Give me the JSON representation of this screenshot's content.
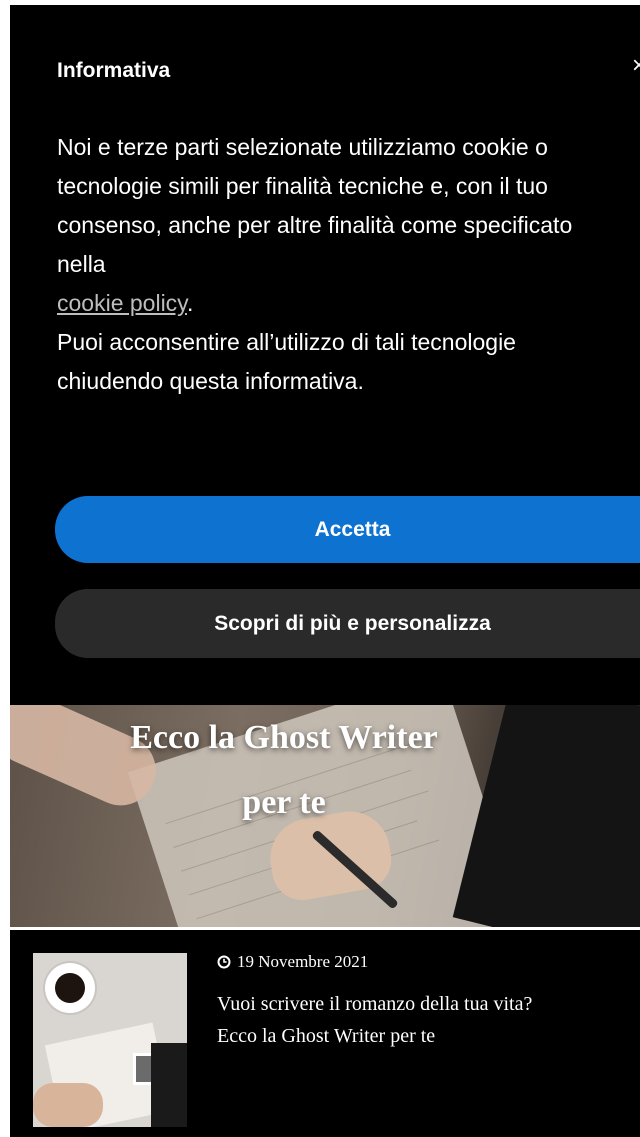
{
  "cookie_banner": {
    "title": "Informativa",
    "close_label": "×",
    "body_intro": "Noi e terze parti selezionate utilizziamo cookie o tecnologie simili per finalità tecniche e, con il tuo consenso, anche per altre finalità come specificato nella",
    "policy_link": "cookie policy",
    "period": ".",
    "body_consent": "Puoi acconsentire all’utilizzo di tali tecnologie chiudendo questa informativa.",
    "accept_label": "Accetta",
    "customize_label": "Scopri di più e personalizza"
  },
  "hero": {
    "title_line1": "Ecco la Ghost Writer",
    "title_line2": "per te"
  },
  "article": {
    "date": "19 Novembre 2021",
    "title": "Vuoi scrivere il romanzo della tua vita? Ecco la Ghost Writer per te"
  },
  "colors": {
    "accent_blue": "#0e73d0",
    "banner_bg": "#000000",
    "secondary_button": "#2a2a2a"
  }
}
